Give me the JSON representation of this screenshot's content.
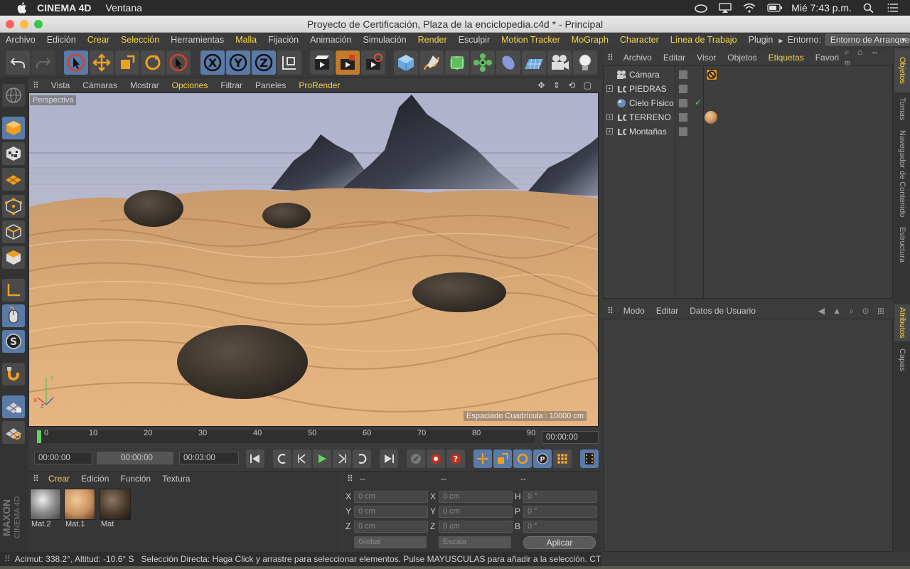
{
  "mac_menubar": {
    "app": "CINEMA 4D",
    "menu": "Ventana",
    "clock": "Mié 7:43 p.m."
  },
  "window": {
    "title": "Proyecto de Certificación, Plaza de la enciclopedia.c4d * - Principal"
  },
  "app_menu": {
    "items": [
      "Archivo",
      "Edición",
      "Crear",
      "Selección",
      "Herramientas",
      "Malla",
      "Fijación",
      "Animación",
      "Simulación",
      "Render",
      "Esculpir",
      "Motion Tracker",
      "MoGraph",
      "Character",
      "Línea de Trabajo",
      "Plugin"
    ],
    "highlighted": [
      "Crear",
      "Selección",
      "Malla",
      "Render",
      "Motion Tracker",
      "MoGraph",
      "Character",
      "Línea de Trabajo"
    ],
    "env_label": "Entorno:",
    "env_value": "Entorno de Arranque"
  },
  "viewport_menu": {
    "items": [
      "Vista",
      "Cámaras",
      "Mostrar",
      "Opciones",
      "Filtrar",
      "Paneles",
      "ProRender"
    ],
    "highlighted": [
      "Opciones",
      "ProRender"
    ]
  },
  "viewport": {
    "camera_label": "Perspectiva",
    "grid_label": "Espaciado Cuadrícula : 10000 cm"
  },
  "timeline": {
    "ticks": [
      "0",
      "10",
      "20",
      "30",
      "40",
      "50",
      "60",
      "70",
      "80",
      "90"
    ],
    "current_frame": "00:00:00"
  },
  "transport": {
    "start": "00:00:00",
    "current": "00:00:00",
    "end": "00:03:00"
  },
  "materials": {
    "menu": [
      "Crear",
      "Edición",
      "Función",
      "Textura"
    ],
    "items": [
      "Mat.2",
      "Mat.1",
      "Mat"
    ]
  },
  "coordinates": {
    "headers": [
      "--",
      "--",
      "--"
    ],
    "pos_labels": [
      "X",
      "Y",
      "Z"
    ],
    "pos_values": [
      "0 cm",
      "0 cm",
      "0 cm"
    ],
    "size_labels": [
      "X",
      "Y",
      "Z"
    ],
    "size_values": [
      "0 cm",
      "0 cm",
      "0 cm"
    ],
    "rot_labels": [
      "H",
      "P",
      "B"
    ],
    "rot_values": [
      "0 °",
      "0 °",
      "0 °"
    ],
    "mode_global": "Global",
    "mode_scale": "Escala",
    "apply": "Aplicar"
  },
  "status": {
    "coords": "Acimut: 338.2°, Altitud: -10.6°  S",
    "message": "Selección Directa: Haga Click y arrastre para seleccionar elementos. Pulse MAYUSCULAS para añadir a la selección. CTRL"
  },
  "object_manager": {
    "menu": [
      "Archivo",
      "Editar",
      "Visor",
      "Objetos",
      "Etiquetas",
      "Favori"
    ],
    "highlighted": [
      "Etiquetas"
    ],
    "objects": [
      {
        "name": "Cámara"
      },
      {
        "name": "PIEDRAS"
      },
      {
        "name": "Cielo Físico"
      },
      {
        "name": "TERRENO"
      },
      {
        "name": "Montañas"
      }
    ]
  },
  "attributes": {
    "menu": [
      "Modo",
      "Editar",
      "Datos de Usuario"
    ]
  },
  "right_tabs": {
    "objetos": "Objetos",
    "tomas": "Tomas",
    "navegador": "Navegador de Contenido",
    "estructura": "Estructura",
    "atributos": "Atributos",
    "capas": "Capas"
  },
  "branding": {
    "maxon": "MAXON",
    "cinema": "CINEMA 4D"
  },
  "colors": {
    "accent": "#f5d34a",
    "active_tool": "#5a7aa8",
    "sand": "#d9a36a",
    "sky": "#b6b9cf"
  }
}
